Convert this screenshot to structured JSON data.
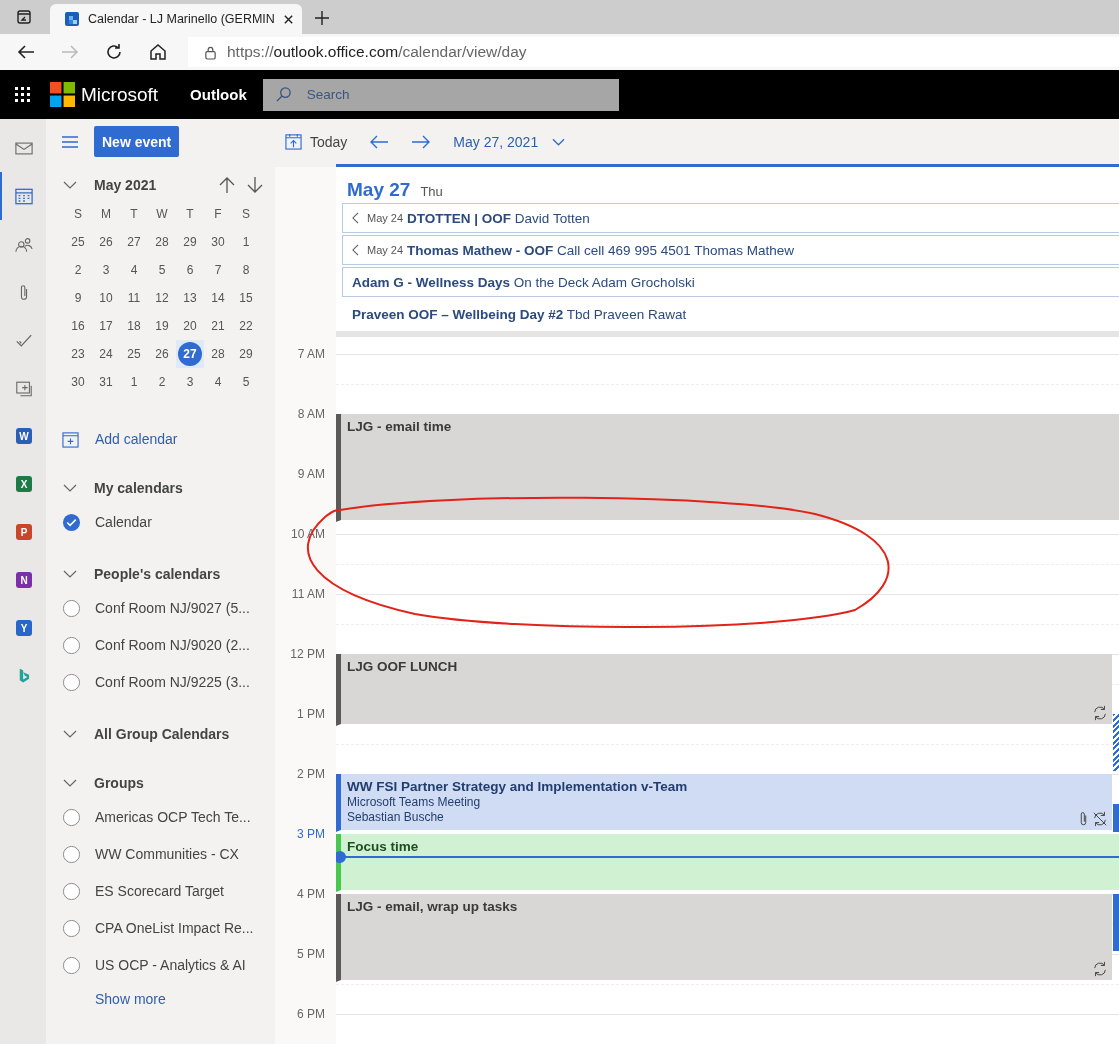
{
  "browser": {
    "tab_title": "Calendar - LJ Marinello (GERMIN",
    "url": {
      "scheme": "https://",
      "host": "outlook.office.com",
      "path": "/calendar/view/day"
    }
  },
  "header": {
    "brand": "Microsoft",
    "app": "Outlook",
    "search": {
      "placeholder": "Search"
    }
  },
  "rail": [
    {
      "selected": false
    },
    {
      "selected": true
    },
    {
      "selected": false
    },
    {
      "selected": false
    },
    {
      "selected": false
    },
    {
      "selected": false
    },
    {
      "letter": "W",
      "color": "#2b5eb7",
      "selected": false
    },
    {
      "letter": "X",
      "color": "#1d7a45",
      "selected": false
    },
    {
      "letter": "P",
      "color": "#c8472a",
      "selected": false
    },
    {
      "letter": "N",
      "color": "#7b2fa8",
      "selected": false
    },
    {
      "letter": "Y",
      "color": "#2867c9",
      "selected": false
    },
    {
      "selected": false
    }
  ],
  "toolbar": {
    "new_event": "New event",
    "today": "Today",
    "date": "May 27, 2021"
  },
  "mini_calendar": {
    "title": "May 2021",
    "expanded": true,
    "weekdays": [
      "S",
      "M",
      "T",
      "W",
      "T",
      "F",
      "S"
    ],
    "weeks": [
      [
        {
          "day": "25",
          "selected": false
        },
        {
          "day": "26",
          "selected": false
        },
        {
          "day": "27",
          "selected": false
        },
        {
          "day": "28",
          "selected": false
        },
        {
          "day": "29",
          "selected": false
        },
        {
          "day": "30",
          "selected": false
        },
        {
          "day": "1",
          "selected": false
        }
      ],
      [
        {
          "day": "2",
          "selected": false
        },
        {
          "day": "3",
          "selected": false
        },
        {
          "day": "4",
          "selected": false
        },
        {
          "day": "5",
          "selected": false
        },
        {
          "day": "6",
          "selected": false
        },
        {
          "day": "7",
          "selected": false
        },
        {
          "day": "8",
          "selected": false
        }
      ],
      [
        {
          "day": "9",
          "selected": false
        },
        {
          "day": "10",
          "selected": false
        },
        {
          "day": "11",
          "selected": false
        },
        {
          "day": "12",
          "selected": false
        },
        {
          "day": "13",
          "selected": false
        },
        {
          "day": "14",
          "selected": false
        },
        {
          "day": "15",
          "selected": false
        }
      ],
      [
        {
          "day": "16",
          "selected": false
        },
        {
          "day": "17",
          "selected": false
        },
        {
          "day": "18",
          "selected": false
        },
        {
          "day": "19",
          "selected": false
        },
        {
          "day": "20",
          "selected": false
        },
        {
          "day": "21",
          "selected": false
        },
        {
          "day": "22",
          "selected": false
        }
      ],
      [
        {
          "day": "23",
          "selected": false
        },
        {
          "day": "24",
          "selected": false
        },
        {
          "day": "25",
          "selected": false
        },
        {
          "day": "26",
          "selected": false
        },
        {
          "day": "27",
          "selected": true
        },
        {
          "day": "28",
          "selected": false
        },
        {
          "day": "29",
          "selected": false
        }
      ],
      [
        {
          "day": "30",
          "selected": false
        },
        {
          "day": "31",
          "selected": false
        },
        {
          "day": "1",
          "selected": false
        },
        {
          "day": "2",
          "selected": false
        },
        {
          "day": "3",
          "selected": false
        },
        {
          "day": "4",
          "selected": false
        },
        {
          "day": "5",
          "selected": false
        }
      ]
    ]
  },
  "calendars": {
    "add": "Add calendar",
    "sections": [
      {
        "title": "My calendars",
        "expanded": true,
        "items": [
          {
            "name": "Calendar",
            "checked": true
          }
        ]
      },
      {
        "title": "People's calendars",
        "expanded": true,
        "items": [
          {
            "name": "Conf Room NJ/9027 (5...",
            "checked": false
          },
          {
            "name": "Conf Room NJ/9020 (2...",
            "checked": false
          },
          {
            "name": "Conf Room NJ/9225 (3...",
            "checked": false
          }
        ]
      },
      {
        "title": "All Group Calendars",
        "expanded": true
      },
      {
        "title": "Groups",
        "expanded": true,
        "items": [
          {
            "name": "Americas OCP Tech Te...",
            "checked": false
          },
          {
            "name": "WW Communities - CX",
            "checked": false
          },
          {
            "name": "ES Scorecard Target",
            "checked": false
          },
          {
            "name": "CPA OneList Impact Re...",
            "checked": false
          },
          {
            "name": "US OCP - Analytics & AI",
            "checked": false
          }
        ]
      }
    ],
    "show_more": "Show more"
  },
  "day": {
    "date": "May 27",
    "weekday": "Thu",
    "all_day": [
      {
        "continued": true,
        "from": "May 24",
        "title": "DTOTTEN | OOF",
        "detail": "David Totten",
        "outlined": true
      },
      {
        "continued": true,
        "from": "May 24",
        "title": "Thomas Mathew - OOF",
        "detail": "Call cell 469 995 4501 Thomas Mathew",
        "outlined": true
      },
      {
        "continued": false,
        "title": "Adam G - Wellness Days",
        "detail": "On the Deck Adam Grocholski",
        "outlined": true
      },
      {
        "continued": false,
        "title": "Praveen OOF – Wellbeing Day #2",
        "detail": "Tbd Praveen Rawat",
        "outlined": false
      }
    ],
    "hours": [
      {
        "label": "7 AM",
        "current": false
      },
      {
        "label": "8 AM",
        "current": false
      },
      {
        "label": "9 AM",
        "current": false
      },
      {
        "label": "10 AM",
        "current": false
      },
      {
        "label": "11 AM",
        "current": false
      },
      {
        "label": "12 PM",
        "current": false
      },
      {
        "label": "1 PM",
        "current": false
      },
      {
        "label": "2 PM",
        "current": false
      },
      {
        "label": "3 PM",
        "current": true
      },
      {
        "label": "4 PM",
        "current": false
      },
      {
        "label": "5 PM",
        "current": false
      },
      {
        "label": "6 PM",
        "current": false
      }
    ],
    "events": [
      {
        "kind": "busy",
        "title": "LJG - email time",
        "recurring": false,
        "attachment": false,
        "exception": false
      },
      {
        "kind": "busy",
        "title": "LJG OOF LUNCH",
        "recurring": true,
        "attachment": false,
        "exception": false
      },
      {
        "kind": "meeting",
        "title": "WW FSI Partner Strategy and Implementation v-Team",
        "subtitle": "Microsoft Teams Meeting",
        "organizer": "Sebastian Busche",
        "recurring": false,
        "attachment": true,
        "exception": true
      },
      {
        "kind": "focus",
        "title": "Focus time",
        "recurring": false,
        "attachment": false,
        "exception": false
      },
      {
        "kind": "busy",
        "title": "LJG - email, wrap up tasks",
        "recurring": true,
        "attachment": false,
        "exception": false
      }
    ],
    "side_marks": [
      {
        "kind": "tentative"
      },
      {
        "kind": "busy"
      },
      {
        "kind": "busy"
      }
    ]
  }
}
